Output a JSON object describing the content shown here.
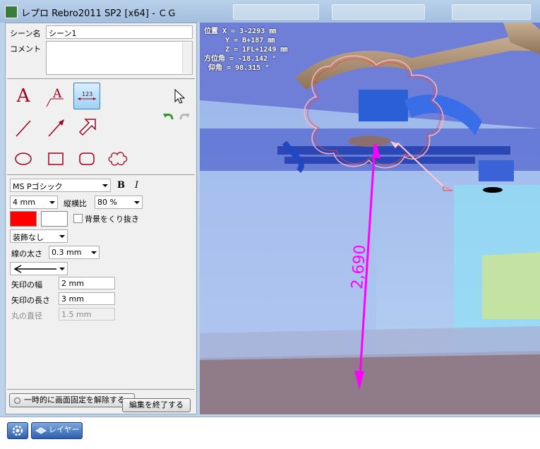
{
  "window": {
    "title": "レプロ Rebro2011 SP2 [x64] - ＣＧ"
  },
  "scene": {
    "name_label": "シーン名",
    "name_value": "シーン1",
    "comment_label": "コメント",
    "comment_value": ""
  },
  "font": {
    "family": "MS Pゴシック",
    "bold_label": "B",
    "italic_label": "I",
    "size": "4 mm",
    "aspect_label": "縦横比",
    "aspect_value": "80 %"
  },
  "colors": {
    "text_color": "#ff0000",
    "bg_color": "#ffffff",
    "view_accent": "#ff00ff"
  },
  "background_clip_label": "背景をくり抜き",
  "decoration": {
    "value": "装飾なし"
  },
  "line_width": {
    "label": "線の太さ",
    "value": "0.3 mm"
  },
  "arrow": {
    "width_label": "矢印の幅",
    "width_value": "2 mm",
    "length_label": "矢印の長さ",
    "length_value": "3 mm",
    "dot_label": "丸の直径",
    "dot_value": "1.5 mm"
  },
  "buttons": {
    "unlock": "一時的に画面固定を解除する",
    "end_edit": "編集を終了する",
    "layer": "レイヤー"
  },
  "view": {
    "coords": "位置 X = 3-2293 ㎜\n     Y = B+187 ㎜\n     Z = 1FL+1249 ㎜\n方位角 = -18.142 °\n 仰角 = 98.315 °",
    "dimension": "2,690"
  },
  "tools": [
    "text-tool",
    "leader-text-tool",
    "dimension-tool",
    "pointer-tool",
    "line-tool",
    "arrow-tool",
    "block-arrow-tool",
    "ellipse-tool",
    "rectangle-tool",
    "rounded-rect-tool",
    "cloud-tool"
  ]
}
